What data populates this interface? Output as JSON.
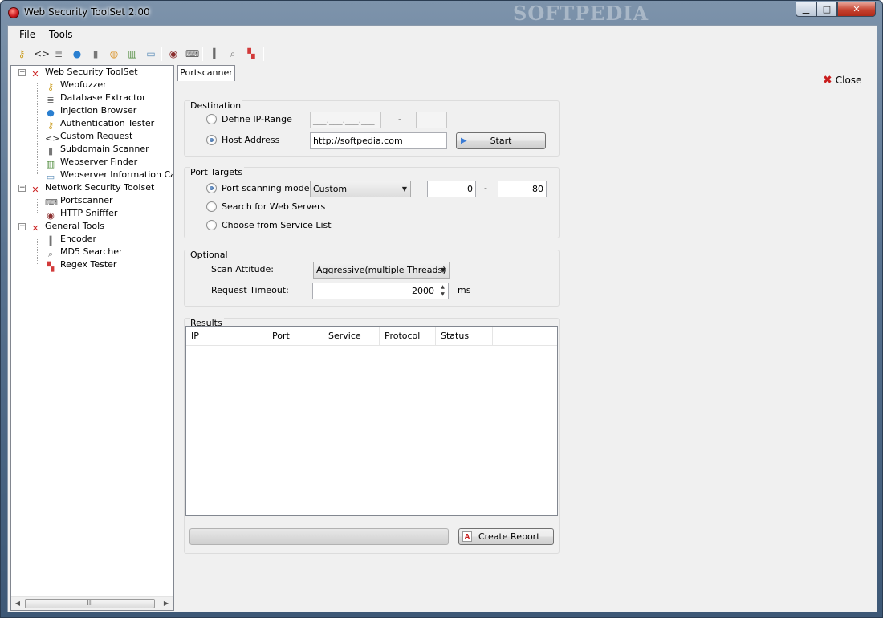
{
  "window": {
    "title": "Web Security ToolSet 2.00",
    "watermark": "SOFTPEDIA",
    "min_glyph": "▁",
    "max_glyph": "□",
    "close_glyph": "✕"
  },
  "menu": [
    "File",
    "Tools"
  ],
  "toolbar_icons": [
    "key-icon",
    "code-brackets-icon",
    "database-icon",
    "globe-icon",
    "server-icon",
    "lock-icon",
    "network-servers-icon",
    "document-icon",
    "eye-icon",
    "keyboard-icon",
    "barcode-icon",
    "magnifier-icon",
    "blocks-icon"
  ],
  "tree": {
    "groups": [
      {
        "label": "Web Security ToolSet",
        "expander": "−",
        "items": [
          "Webfuzzer",
          "Database Extractor",
          "Injection Browser",
          "Authentication Tester",
          "Custom Request",
          "Subdomain Scanner",
          "Webserver Finder",
          "Webserver Information Catche"
        ]
      },
      {
        "label": "Network Security Toolset",
        "expander": "−",
        "items": [
          "Portscanner",
          "HTTP Snifffer"
        ]
      },
      {
        "label": "General Tools",
        "expander": "−",
        "items": [
          "Encoder",
          "MD5 Searcher",
          "Regex Tester"
        ]
      }
    ],
    "scroll_grip": "III"
  },
  "tab": {
    "label": "Portscanner"
  },
  "close": {
    "label": "Close",
    "glyph": "✖"
  },
  "destination": {
    "title": "Destination",
    "ip_range_label": "Define IP-Range",
    "ip_mask": "___.___.___.___",
    "dash": "-",
    "host_label": "Host Address",
    "host_value": "http://softpedia.com",
    "start_label": "Start",
    "start_glyph": "▶"
  },
  "port_targets": {
    "title": "Port Targets",
    "mode_label": "Port scanning mode",
    "mode_value": "Custom",
    "port_from": "0",
    "dash": "-",
    "port_to": "80",
    "web_servers_label": "Search for Web Servers",
    "service_list_label": "Choose from Service List"
  },
  "optional": {
    "title": "Optional",
    "attitude_label": "Scan Attitude:",
    "attitude_value": "Aggressive(multiple Threads)",
    "timeout_label": "Request Timeout:",
    "timeout_value": "2000",
    "unit": "ms",
    "dropdown_glyph": "▼",
    "spin_up": "▲",
    "spin_down": "▼"
  },
  "results": {
    "title": "Results",
    "columns": [
      "IP",
      "Port",
      "Service",
      "Protocol",
      "Status"
    ],
    "create_report_label": "Create Report"
  },
  "colors": {
    "accent": "#1d4f8c",
    "close_red": "#c91e1e"
  }
}
